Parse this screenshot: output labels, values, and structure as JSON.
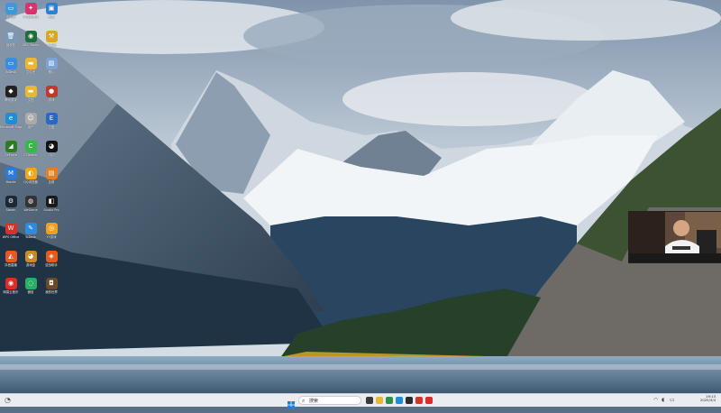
{
  "desktop": {
    "icons": [
      {
        "name": "Computer",
        "label": "此电脑",
        "color": "#3a9ad9",
        "glyph": "▭",
        "icon": "computer-icon"
      },
      {
        "name": "BizApp",
        "label": "扩展管理器",
        "color": "#d9326d",
        "glyph": "✦",
        "icon": "bizapp-icon"
      },
      {
        "name": "Screenshot",
        "label": "截图",
        "color": "#2d7fd3",
        "glyph": "▣",
        "icon": "screenshot-icon"
      },
      {
        "name": "Recycle",
        "label": "回收站",
        "color": "#7a99b8",
        "glyph": "🗑",
        "icon": "recycle-bin-icon"
      },
      {
        "name": "Obs",
        "label": "OBS Studio",
        "color": "#1f6e3a",
        "glyph": "◉",
        "icon": "obs-icon"
      },
      {
        "name": "Tool",
        "label": "工具箱",
        "color": "#d9a820",
        "glyph": "⚒",
        "icon": "toolbox-icon"
      },
      {
        "name": "Monitor",
        "label": "ToDesk",
        "color": "#3a8dd9",
        "glyph": "▭",
        "icon": "monitor-icon"
      },
      {
        "name": "Folder",
        "label": "文件夹",
        "color": "#e8b832",
        "glyph": "▬",
        "icon": "folder-icon"
      },
      {
        "name": "Picture",
        "label": "照片",
        "color": "#7aa3d8",
        "glyph": "▨",
        "icon": "picture-icon"
      },
      {
        "name": "Game1",
        "label": "腾讯游戏",
        "color": "#222",
        "glyph": "◆",
        "icon": "game-icon"
      },
      {
        "name": "Folder2",
        "label": "文档",
        "color": "#e8b832",
        "glyph": "▬",
        "icon": "folder-icon"
      },
      {
        "name": "Mario",
        "label": "游戏",
        "color": "#c0392b",
        "glyph": "●",
        "icon": "mario-icon"
      },
      {
        "name": "Edge",
        "label": "Microsoft Edge",
        "color": "#1b8fd6",
        "glyph": "e",
        "icon": "edge-icon"
      },
      {
        "name": "Person",
        "label": "用户",
        "color": "#aaa",
        "glyph": "☺",
        "icon": "person-icon"
      },
      {
        "name": "Efile",
        "label": "云盘",
        "color": "#2b67c9",
        "glyph": "E",
        "icon": "e-icon"
      },
      {
        "name": "Nvidia",
        "label": "GeForce",
        "color": "#2f7a2a",
        "glyph": "◢",
        "icon": "nvidia-icon"
      },
      {
        "name": "Ccleaner",
        "label": "CCleaner",
        "color": "#3bb54a",
        "glyph": "C",
        "icon": "cleaner-icon"
      },
      {
        "name": "QQ",
        "label": "QQ",
        "color": "#111",
        "glyph": "◕",
        "icon": "qq-icon"
      },
      {
        "name": "Mobile",
        "label": "Mobile",
        "color": "#2e7bd6",
        "glyph": "M",
        "icon": "mobile-icon"
      },
      {
        "name": "QQBrowser",
        "label": "QQ浏览器",
        "color": "#f2a71b",
        "glyph": "◐",
        "icon": "browser-icon"
      },
      {
        "name": "Box",
        "label": "应用",
        "color": "#e67e22",
        "glyph": "▤",
        "icon": "box-icon"
      },
      {
        "name": "Steam",
        "label": "Steam",
        "color": "#1b2838",
        "glyph": "⚙",
        "icon": "steam-icon"
      },
      {
        "name": "Wallpaper",
        "label": "WeGame",
        "color": "#333",
        "glyph": "◍",
        "icon": "wegame-icon"
      },
      {
        "name": "Studio",
        "label": "Studio Pro",
        "color": "#1a1a1a",
        "glyph": "◧",
        "icon": "studio-icon"
      },
      {
        "name": "WPS",
        "label": "WPS Office",
        "color": "#d8312a",
        "glyph": "W",
        "icon": "wps-icon"
      },
      {
        "name": "Pen",
        "label": "ToDesk",
        "color": "#2d8ce0",
        "glyph": "✎",
        "icon": "pen-icon"
      },
      {
        "name": "Owl",
        "label": "YY游戏",
        "color": "#f0a020",
        "glyph": "◎",
        "icon": "owl-icon"
      },
      {
        "name": "Orange",
        "label": "抖音直播",
        "color": "#e6572a",
        "glyph": "◭",
        "icon": "orange-app-icon"
      },
      {
        "name": "Bear",
        "label": "游戏盒",
        "color": "#c98a2a",
        "glyph": "◕",
        "icon": "bear-icon"
      },
      {
        "name": "Game2",
        "label": "逆战助手",
        "color": "#e65a1a",
        "glyph": "◈",
        "icon": "game2-icon"
      },
      {
        "name": "Red",
        "label": "网易云音乐",
        "color": "#d92c2c",
        "glyph": "◉",
        "icon": "red-app-icon"
      },
      {
        "name": "WeChat",
        "label": "微信",
        "color": "#2aae67",
        "glyph": "◌",
        "icon": "wechat-icon"
      },
      {
        "name": "Game3",
        "label": "我的世界",
        "color": "#6b4a2a",
        "glyph": "◘",
        "icon": "game3-icon"
      }
    ]
  },
  "taskbar": {
    "search_placeholder": "搜索",
    "tray_time": "19:13",
    "tray_date": "2025/3/4",
    "apps": [
      {
        "icon": "task-view-icon",
        "color": "#3a3a3a"
      },
      {
        "icon": "file-explorer-icon",
        "color": "#e8b832"
      },
      {
        "icon": "chrome-icon",
        "color": "#2f8f4a"
      },
      {
        "icon": "edge-icon",
        "color": "#1b8fd6"
      },
      {
        "icon": "terminal-icon",
        "color": "#2b2b2b"
      },
      {
        "icon": "wps-icon",
        "color": "#d8312a"
      },
      {
        "icon": "red-app-icon",
        "color": "#d92c2c"
      }
    ]
  },
  "webcam": {
    "label": ""
  }
}
